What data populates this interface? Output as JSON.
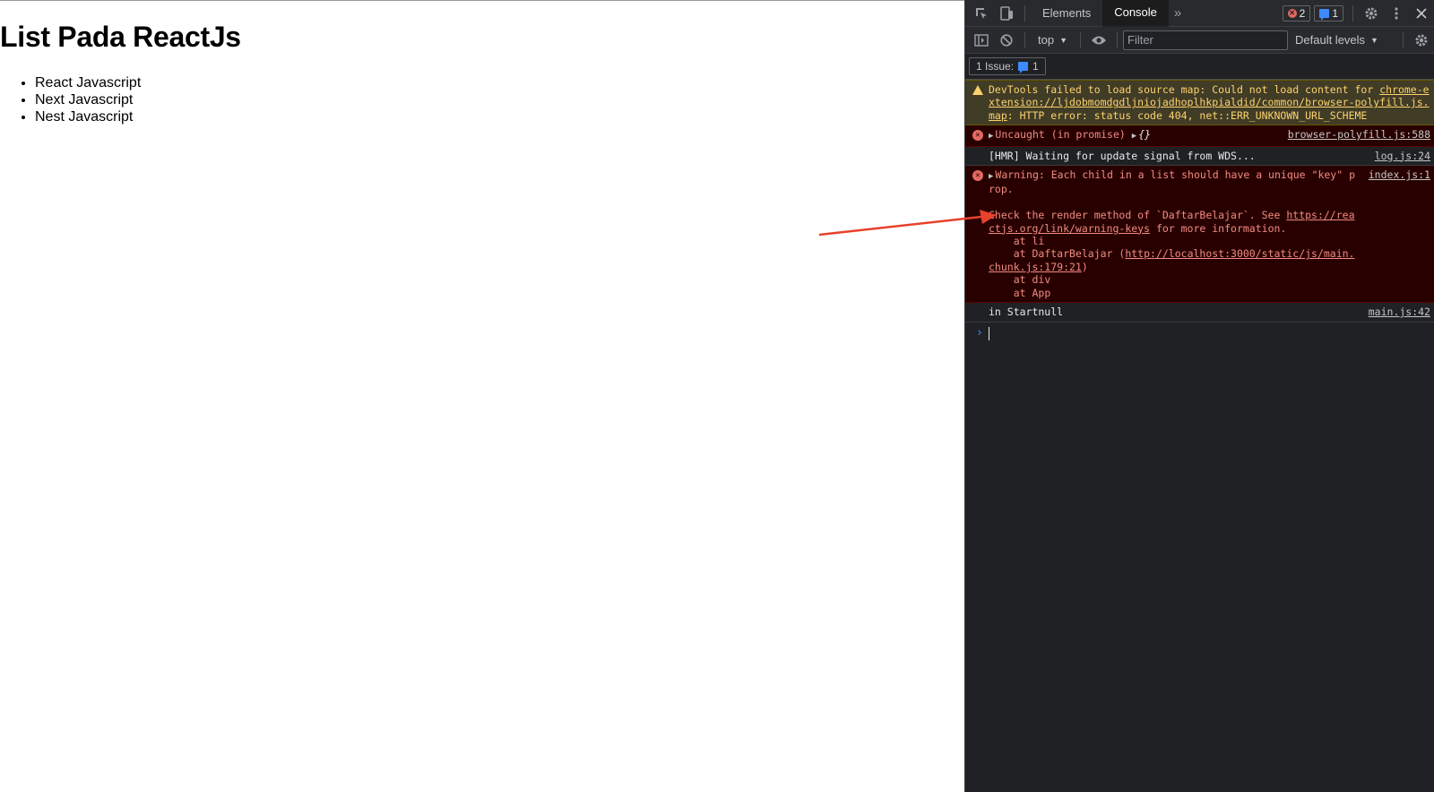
{
  "page": {
    "title": "List Pada ReactJs",
    "items": [
      "React Javascript",
      "Next Javascript",
      "Nest Javascript"
    ]
  },
  "devtools": {
    "tabs": [
      {
        "label": "Elements",
        "active": false
      },
      {
        "label": "Console",
        "active": true
      }
    ],
    "error_count": "2",
    "message_count": "1",
    "context": "top",
    "filter_placeholder": "Filter",
    "levels_label": "Default levels",
    "issues_label": "1 Issue:",
    "issues_count": "1",
    "console": {
      "warn_source_map": {
        "prefix": "DevTools failed to load source map: Could not load content for ",
        "url": "chrome-extension://ljdobmomdgdljniojadhoplhkpialdid/common/browser-polyfill.js.map",
        "suffix": ": HTTP error: status code 404, net::ERR_UNKNOWN_URL_SCHEME"
      },
      "uncaught": {
        "text": "Uncaught (in promise)",
        "object": "{}",
        "source": "browser-polyfill.js:588"
      },
      "hmr": {
        "text": "[HMR] Waiting for update signal from WDS...",
        "source": "log.js:24"
      },
      "key_warning": {
        "line1": "Warning: Each child in a list should have a unique \"key\" prop.",
        "source": "index.js:1",
        "check_prefix": "Check the render method of `DaftarBelajar`. See ",
        "check_link": "https://reactjs.org/link/warning-keys",
        "check_suffix": " for more information.",
        "at_li": "    at li",
        "at_daftar_prefix": "    at DaftarBelajar (",
        "at_daftar_link": "http://localhost:3000/static/js/main.chunk.js:179:21",
        "at_daftar_suffix": ")",
        "at_div": "    at div",
        "at_app": "    at App"
      },
      "startnull": {
        "text": "in Startnull",
        "source": "main.js:42"
      }
    }
  },
  "colors": {
    "devtools_bg": "#202124",
    "warning_bg": "#413c26",
    "warning_text": "#fcd26d",
    "error_bg": "#290000",
    "error_text": "#f28b82",
    "arrow": "#e8412c"
  }
}
